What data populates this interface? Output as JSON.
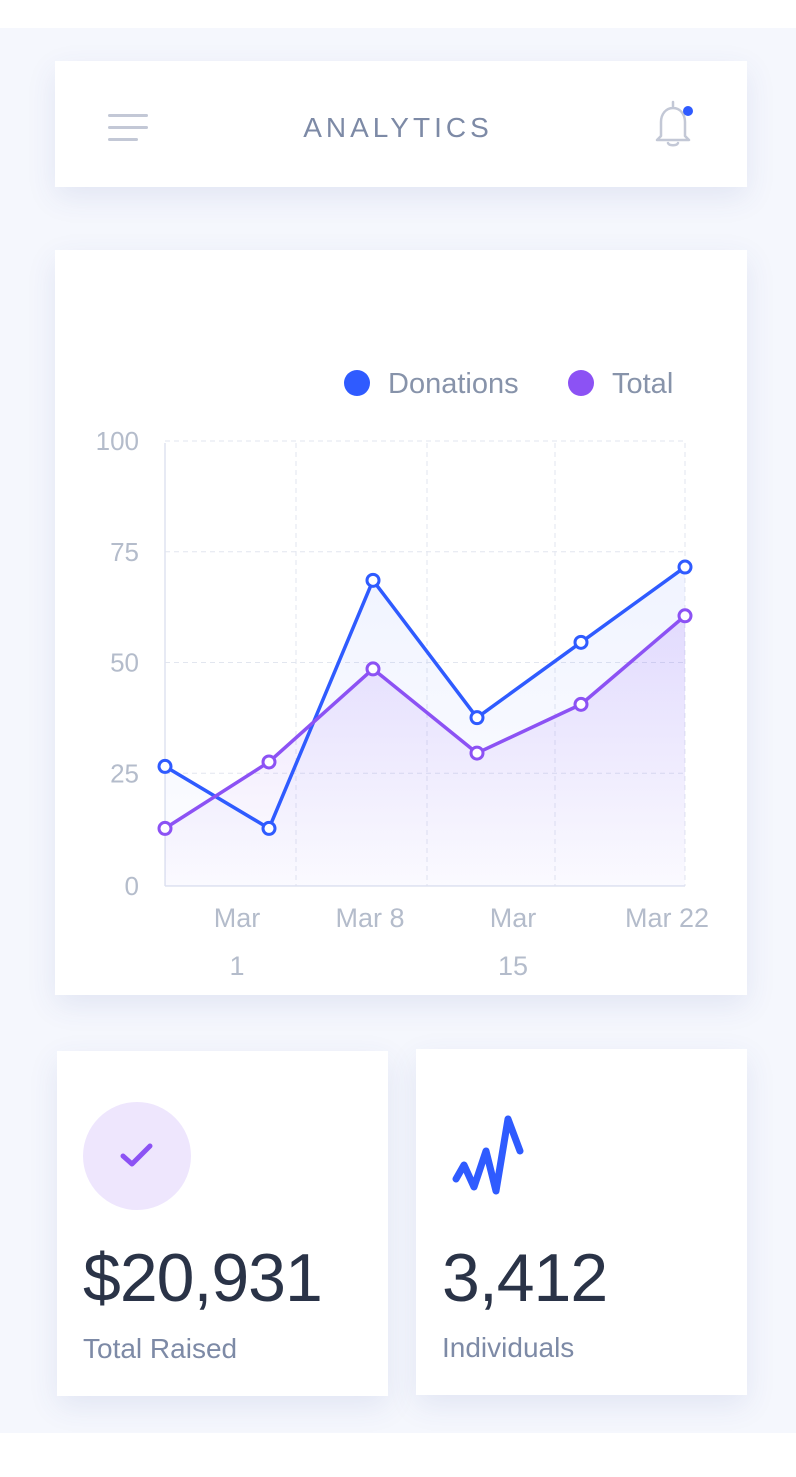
{
  "header": {
    "title": "ANALYTICS",
    "menu_icon": "hamburger-menu-icon",
    "bell_icon": "bell-icon",
    "notification_dot_color": "#2f5bff"
  },
  "chart_data": {
    "type": "line",
    "categories": [
      "",
      "Mar 1",
      "Mar 8",
      "",
      "Mar 15",
      "Mar 22"
    ],
    "x": [
      0,
      1,
      2,
      3,
      4,
      5
    ],
    "series": [
      {
        "name": "Donations",
        "color": "#2f5bff",
        "values": [
          27,
          13,
          69,
          38,
          55,
          72
        ]
      },
      {
        "name": "Total",
        "color": "#8c52f4",
        "values": [
          13,
          28,
          49,
          30,
          41,
          61
        ]
      }
    ],
    "yticks": [
      "0",
      "25",
      "50",
      "75",
      "100"
    ],
    "ylim": [
      0,
      100
    ],
    "grid": true,
    "legend": "top-right"
  },
  "stats": [
    {
      "value": "$20,931",
      "label": "Total Raised",
      "icon": "checkmark-icon",
      "accent": "#8c52f4"
    },
    {
      "value": "3,412",
      "label": "Individuals",
      "icon": "pulse-icon",
      "accent": "#2f5bff"
    }
  ]
}
